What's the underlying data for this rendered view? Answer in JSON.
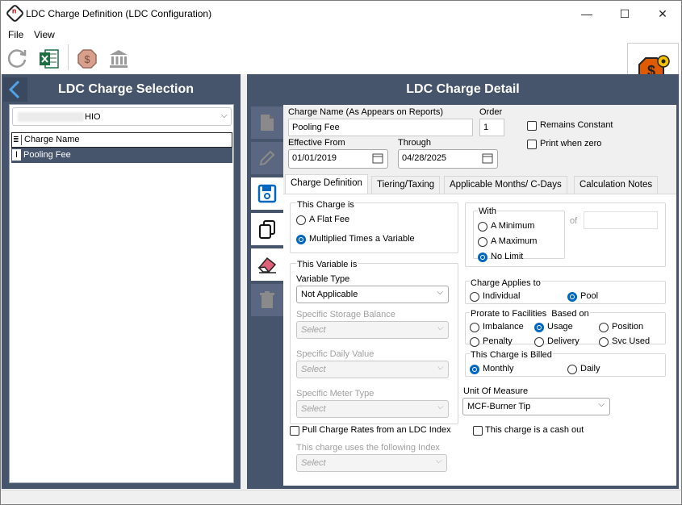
{
  "window": {
    "title": "LDC Charge Definition (LDC Configuration)",
    "minimize_glyph": "—",
    "maximize_glyph": "☐",
    "close_glyph": "✕"
  },
  "menu": [
    "File",
    "View"
  ],
  "toolbar": {
    "icons": [
      "refresh-icon",
      "excel-icon",
      "dollar-octagon-icon",
      "bank-icon"
    ],
    "badge_icon": "dollar-gear-badge-icon"
  },
  "left_panel": {
    "title": "LDC Charge Selection",
    "ldc_select_value": "HIO",
    "table": {
      "header": "Charge Name",
      "rows": [
        "Pooling Fee"
      ]
    }
  },
  "right_panel": {
    "title": "LDC Charge Detail",
    "sidebar_icons": [
      "new-document-icon",
      "edit-pencil-icon",
      "save-disk-icon",
      "copy-icon",
      "eraser-icon",
      "delete-trash-icon"
    ],
    "charge_name_label": "Charge Name (As Appears on Reports)",
    "charge_name_value": "Pooling Fee",
    "order_label": "Order",
    "order_value": "1",
    "effective_from_label": "Effective From",
    "effective_from_value": "01/01/2019",
    "through_label": "Through",
    "through_value": "04/28/2025",
    "remains_constant_label": "Remains Constant",
    "print_when_zero_label": "Print when zero",
    "tabs": [
      "Charge Definition",
      "Tiering/Taxing",
      "Applicable Months/ C-Days",
      "Calculation Notes"
    ],
    "this_charge_is": {
      "label": "This Charge is",
      "options": [
        "A Flat Fee",
        "Multiplied Times a Variable"
      ],
      "selected": "Multiplied Times a Variable"
    },
    "with": {
      "label": "With",
      "options": [
        "A Minimum",
        "A Maximum",
        "No Limit"
      ],
      "selected": "No Limit",
      "of_label": "of"
    },
    "this_variable_is": {
      "label": "This Variable is",
      "variable_type_label": "Variable Type",
      "variable_type_value": "Not Applicable",
      "storage_label": "Specific Storage Balance",
      "daily_label": "Specific Daily Value",
      "meter_label": "Specific Meter Type",
      "select_placeholder": "Select"
    },
    "charge_applies_to": {
      "label": "Charge Applies to",
      "options": [
        "Individual",
        "Pool"
      ],
      "selected": "Pool"
    },
    "prorate": {
      "label": "Prorate to Facilities  Based on",
      "options": [
        "Imbalance",
        "Usage",
        "Position",
        "Penalty",
        "Delivery",
        "Svc Used"
      ],
      "selected": "Usage"
    },
    "billed": {
      "label": "This Charge is Billed",
      "options": [
        "Monthly",
        "Daily"
      ],
      "selected": "Monthly"
    },
    "unit_of_measure_label": "Unit Of Measure",
    "unit_of_measure_value": "MCF-Burner Tip",
    "pull_rates_label": "Pull Charge Rates from an LDC Index",
    "cash_out_label": "This charge is a cash out",
    "index_label": "This charge uses the following Index",
    "index_placeholder": "Select"
  },
  "colors": {
    "panel_bg": "#46546c",
    "accent_blue": "#0067c0",
    "selected_row": "#46546c"
  }
}
